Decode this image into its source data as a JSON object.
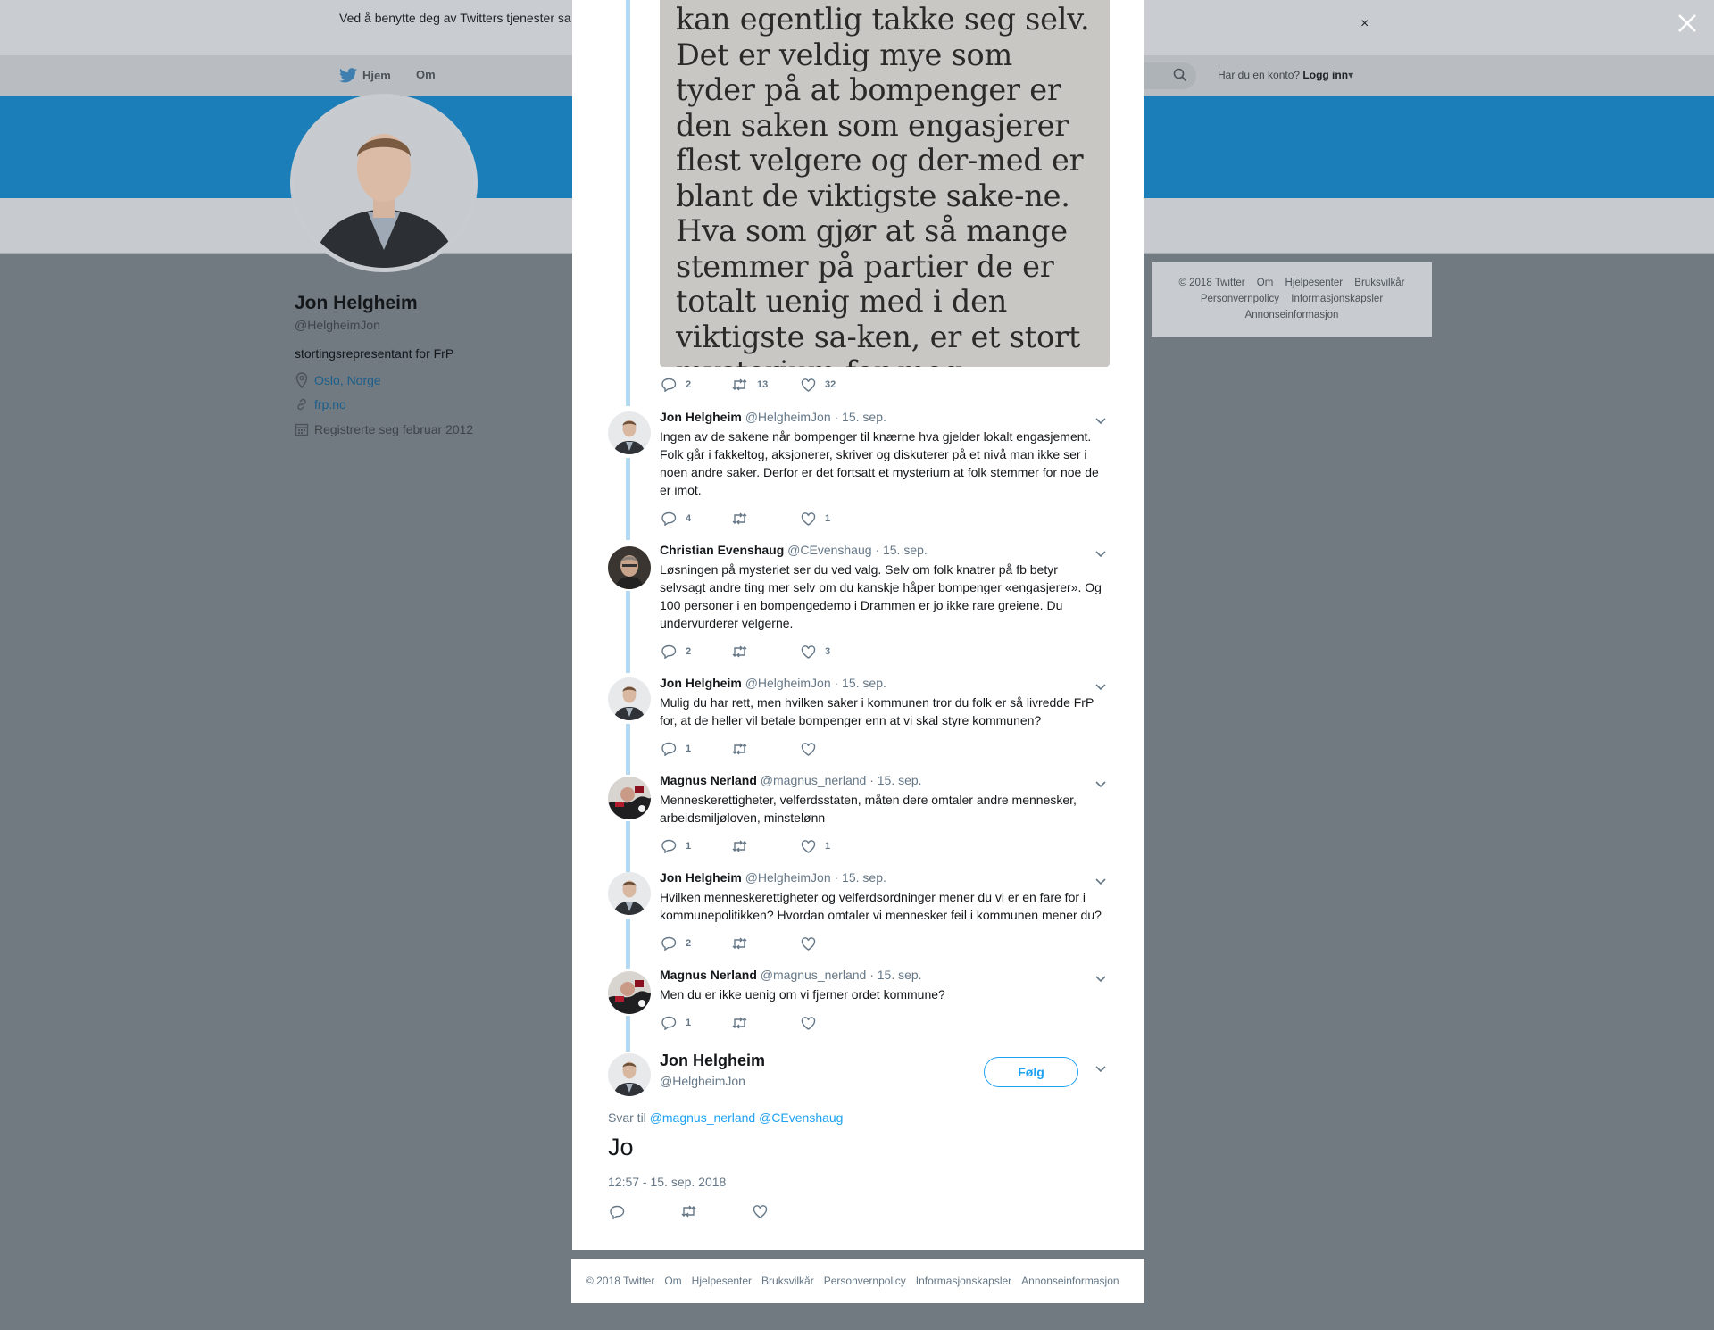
{
  "cookie_bar": {
    "text": "Ved å benytte deg av Twitters tjenester sa                                                                                    informasjonskapsler til bl.a. analyser, personalisering og annonser.",
    "close": "×"
  },
  "topnav": {
    "home": "Hjem",
    "about": "Om",
    "account_prompt": "Har du en konto?",
    "login": "Logg inn"
  },
  "profile": {
    "name": "Jon Helgheim",
    "handle": "@HelgheimJon",
    "bio": "stortingsrepresentant for FrP",
    "location": "Oslo, Norge",
    "website": "frp.no",
    "joined": "Registrerte seg februar 2012"
  },
  "side_footer": {
    "line1": [
      "© 2018 Twitter",
      "Om",
      "Hjelpesenter",
      "Bruksvilkår"
    ],
    "line2": [
      "Personvernpolicy",
      "Informasjonskapsler"
    ],
    "line3": [
      "Annonseinformasjon"
    ]
  },
  "image_tweet": {
    "image_text": "kan egentlig takke seg selv. Det er veldig mye som tyder på at bompenger er den saken som engasjerer flest velgere og der-med er blant de viktigste sake-ne. Hva som gjør at så mange stemmer på partier de er totalt uenig med i den viktigste sa-ken, er et stort mysterium for meg.",
    "replies": "2",
    "retweets": "13",
    "likes": "32"
  },
  "tweets": [
    {
      "name": "Jon Helgheim",
      "handle": "@HelgheimJon",
      "date": "· 15. sep.",
      "text": "Ingen av de sakene når bompenger til knærne hva gjelder lokalt engasjement. Folk går i fakkeltog, aksjonerer, skriver og diskuterer på et nivå man ikke ser i noen andre saker. Derfor er det fortsatt et mysterium at folk stemmer for noe de er imot.",
      "replies": "4",
      "retweets": "",
      "likes": "1"
    },
    {
      "name": "Christian Evenshaug",
      "handle": "@CEvenshaug",
      "date": "· 15. sep.",
      "text": "Løsningen på mysteriet ser du ved valg. Selv om folk knatrer på fb betyr selvsagt andre ting mer selv om du kanskje håper bompenger «engasjerer». Og 100 personer i en bompengedemo i Drammen er jo ikke rare greiene. Du undervurderer velgerne.",
      "replies": "2",
      "retweets": "",
      "likes": "3"
    },
    {
      "name": "Jon Helgheim",
      "handle": "@HelgheimJon",
      "date": "· 15. sep.",
      "text": "Mulig du har rett, men hvilken saker i kommunen tror du folk er så livredde FrP for, at de heller vil betale bompenger enn at vi skal styre kommunen?",
      "replies": "1",
      "retweets": "",
      "likes": ""
    },
    {
      "name": "Magnus Nerland",
      "handle": "@magnus_nerland",
      "date": "· 15. sep.",
      "text": "Menneskerettigheter, velferdsstaten, måten dere omtaler andre mennesker, arbeidsmiljøloven, minstelønn",
      "replies": "1",
      "retweets": "",
      "likes": "1"
    },
    {
      "name": "Jon Helgheim",
      "handle": "@HelgheimJon",
      "date": "· 15. sep.",
      "text": "Hvilken menneskerettigheter og velferdsordninger mener du vi er en fare for i kommunepolitikken? Hvordan omtaler vi mennesker feil i kommunen mener du?",
      "replies": "2",
      "retweets": "",
      "likes": ""
    },
    {
      "name": "Magnus Nerland",
      "handle": "@magnus_nerland",
      "date": "· 15. sep.",
      "text": "Men du er ikke uenig om vi fjerner ordet kommune?",
      "replies": "1",
      "retweets": "",
      "likes": ""
    }
  ],
  "main_tweet": {
    "name": "Jon Helgheim",
    "handle": "@HelgheimJon",
    "follow": "Følg",
    "reply_prefix": "Svar til",
    "reply_mentions": "@magnus_nerland @CEvenshaug",
    "text": "Jo",
    "timestamp": "12:57 - 15. sep. 2018"
  },
  "modal_footer": [
    "© 2018 Twitter",
    "Om",
    "Hjelpesenter",
    "Bruksvilkår",
    "Personvernpolicy",
    "Informasjonskapsler",
    "Annonseinformasjon"
  ],
  "colors": {
    "accent": "#1da1f2",
    "thread_line": "#b3d9f3",
    "overlay": "#717a81"
  }
}
